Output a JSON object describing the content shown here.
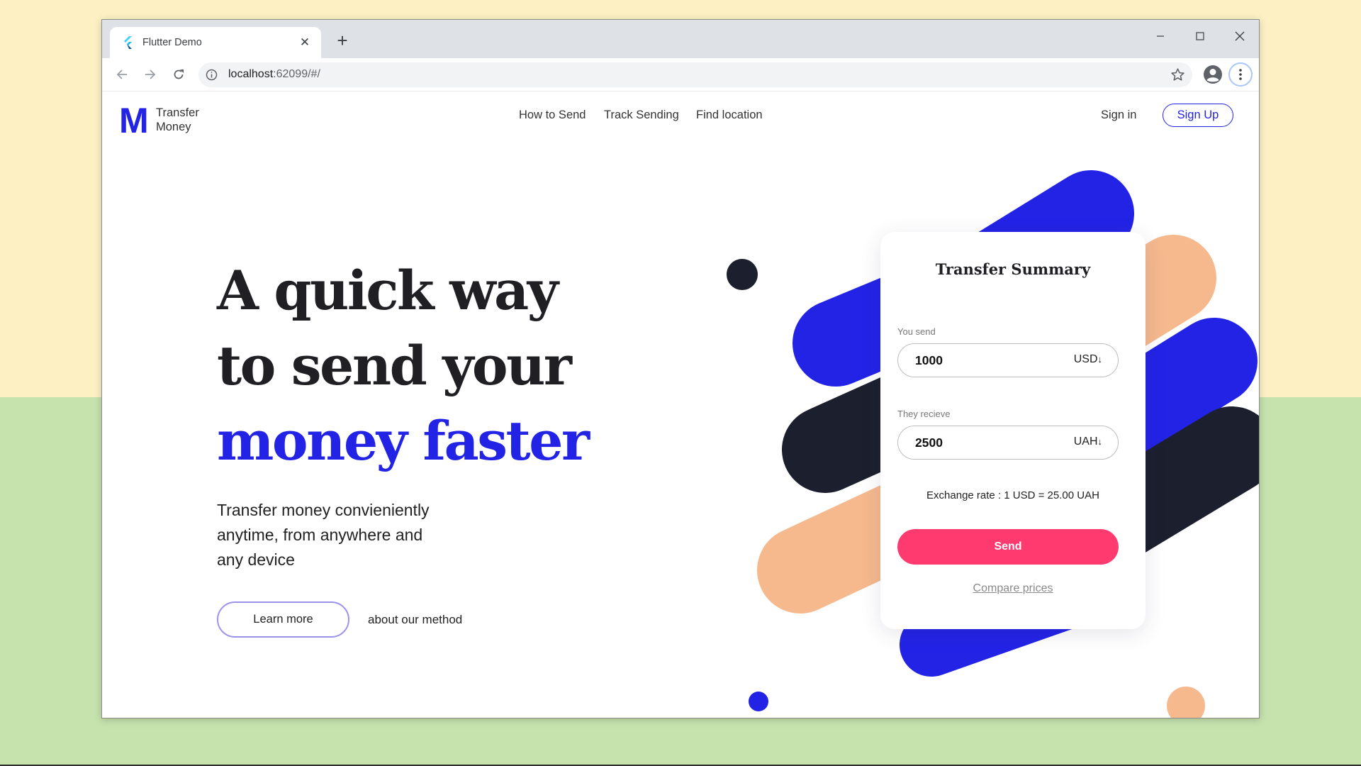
{
  "browser": {
    "tab_title": "Flutter Demo",
    "url_host": "localhost",
    "url_path": ":62099/#/",
    "icons": [
      "flutter-favicon",
      "close-icon",
      "plus-icon",
      "minimize-icon",
      "maximize-icon",
      "window-close-icon",
      "back-arrow-icon",
      "forward-arrow-icon",
      "reload-icon",
      "info-icon",
      "star-icon",
      "profile-icon",
      "more-vert-icon"
    ]
  },
  "nav": {
    "logo_letter": "M",
    "logo_line1": "Transfer",
    "logo_line2": "Money",
    "links": [
      "How to Send",
      "Track Sending",
      "Find location"
    ],
    "sign_in": "Sign in",
    "sign_up": "Sign Up"
  },
  "hero": {
    "line1": "A quick way",
    "line2": "to send your",
    "line3": "money faster",
    "sub1": "Transfer money convieniently",
    "sub2": "anytime, from anywhere and",
    "sub3": "any device",
    "learn_more": "Learn more",
    "about": "about our method"
  },
  "card": {
    "title": "Transfer Summary",
    "send_label": "You send",
    "send_amount": "1000",
    "send_currency": "USD",
    "receive_label": "They recieve",
    "receive_amount": "2500",
    "receive_currency": "UAH",
    "exchange_rate": "Exchange rate : 1 USD = 25.00 UAH",
    "send_button": "Send",
    "compare_link": "Compare prices"
  },
  "colors": {
    "accent_blue": "#2323e6",
    "dark_navy": "#1b1f2e",
    "peach": "#f6b98e",
    "send_pink": "#ff3a6e"
  }
}
